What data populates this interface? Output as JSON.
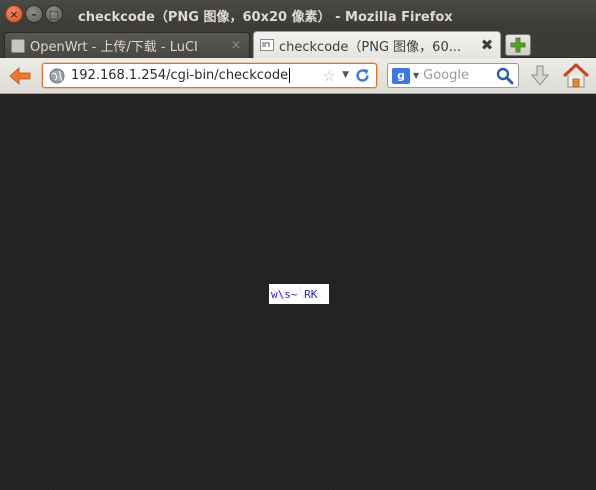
{
  "window": {
    "title": "checkcode（PNG 图像，60x20 像素） - Mozilla Firefox",
    "buttons": {
      "close": "×",
      "minimize": "–",
      "maximize": "□"
    }
  },
  "tabs": [
    {
      "label": "OpenWrt - 上传/下载 - LuCI",
      "active": false,
      "close": "×"
    },
    {
      "label": "checkcode（PNG 图像，60...",
      "active": true,
      "close": "✖"
    }
  ],
  "toolbar": {
    "url": "192.168.1.254/cgi-bin/checkcode",
    "search_engine_letter": "g",
    "search_placeholder": "Google"
  },
  "content": {
    "image_text": "w\\s~ RK"
  },
  "colors": {
    "titlebar_bg": "#3c3b37",
    "page_bg": "#222222",
    "url_focus": "#e0702a",
    "captcha_text": "#2a1fd0"
  },
  "icons": [
    "back-arrow-icon",
    "globe-icon",
    "star-icon",
    "reload-icon",
    "google-icon",
    "search-icon",
    "download-icon",
    "home-icon",
    "new-tab-icon"
  ]
}
